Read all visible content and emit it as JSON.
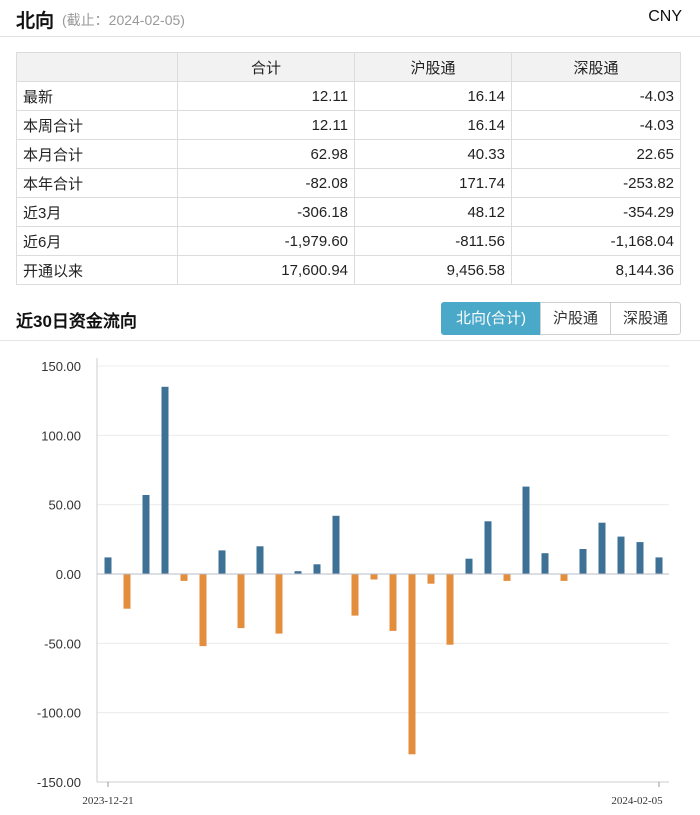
{
  "header": {
    "title": "北向",
    "as_of": "(截止：2024-02-05)",
    "currency": "CNY"
  },
  "summary": {
    "columns": [
      "",
      "合计",
      "沪股通",
      "深股通"
    ],
    "rows": [
      {
        "label": "最新",
        "total": "12.11",
        "sh": "16.14",
        "sz": "-4.03"
      },
      {
        "label": "本周合计",
        "total": "12.11",
        "sh": "16.14",
        "sz": "-4.03"
      },
      {
        "label": "本月合计",
        "total": "62.98",
        "sh": "40.33",
        "sz": "22.65"
      },
      {
        "label": "本年合计",
        "total": "-82.08",
        "sh": "171.74",
        "sz": "-253.82"
      },
      {
        "label": "近3月",
        "total": "-306.18",
        "sh": "48.12",
        "sz": "-354.29"
      },
      {
        "label": "近6月",
        "total": "-1,979.60",
        "sh": "-811.56",
        "sz": "-1,168.04"
      },
      {
        "label": "开通以来",
        "total": "17,600.94",
        "sh": "9,456.58",
        "sz": "8,144.36"
      }
    ]
  },
  "flow": {
    "title": "近30日资金流向",
    "tabs": [
      {
        "label": "北向(合计)",
        "active": true
      },
      {
        "label": "沪股通",
        "active": false
      },
      {
        "label": "深股通",
        "active": false
      }
    ]
  },
  "colors": {
    "positive": "#3e7196",
    "negative": "#e38e3c",
    "tab_active": "#4aa9c9"
  },
  "chart_data": {
    "type": "bar",
    "title": "",
    "xlabel": "",
    "ylabel": "",
    "ylim": [
      -150,
      150
    ],
    "yticks": [
      "150.00",
      "100.00",
      "50.00",
      "0.00",
      "-50.00",
      "-100.00",
      "-150.00"
    ],
    "x_start_label": "2023-12-21",
    "x_end_label": "2024-02-05",
    "grid": "horizontal",
    "values": [
      12,
      -25,
      57,
      135,
      -5,
      -52,
      17,
      -39,
      20,
      -43,
      2,
      7,
      42,
      -30,
      -4,
      -41,
      -130,
      -7,
      -51,
      11,
      38,
      -5,
      63,
      15,
      -5,
      18,
      37,
      27,
      23,
      12
    ]
  }
}
